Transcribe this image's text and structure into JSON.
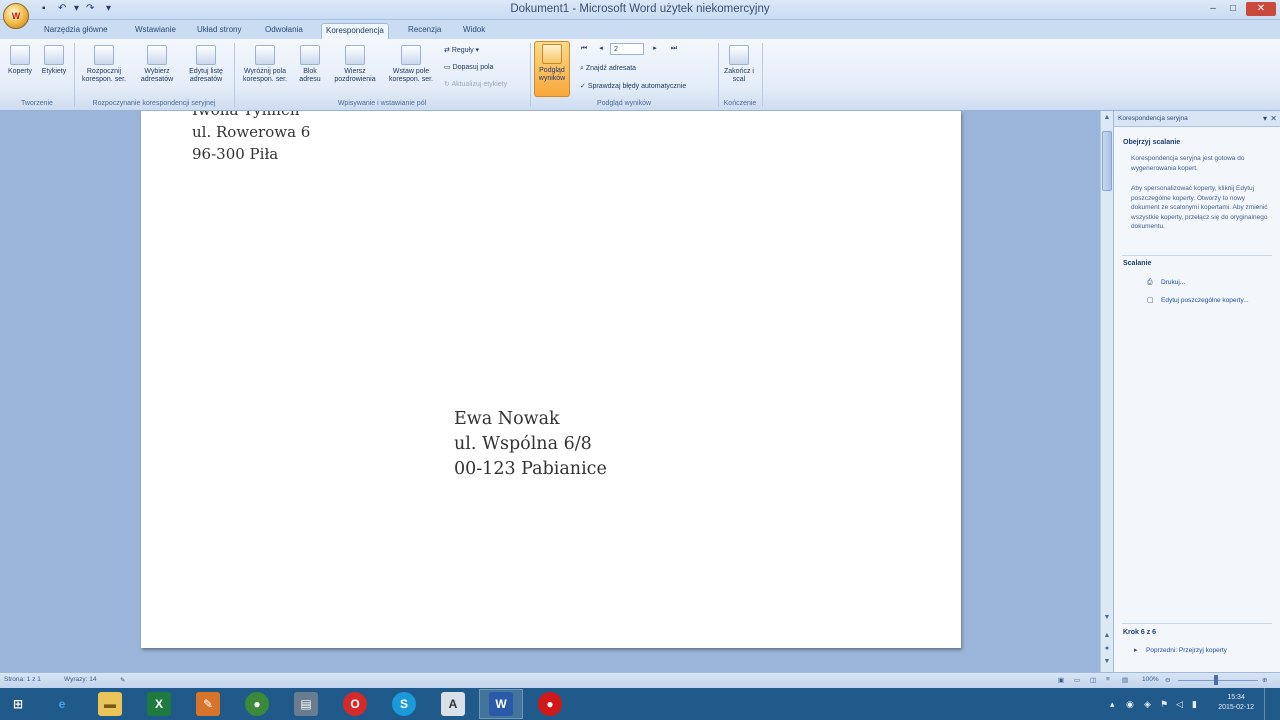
{
  "titlebar": {
    "title": "Dokument1 - Microsoft Word użytek niekomercyjny",
    "minimize": "–",
    "maximize": "□",
    "close": "✕"
  },
  "tabs": [
    "Narzędzia główne",
    "Wstawianie",
    "Układ strony",
    "Odwołania",
    "Korespondencja",
    "Recenzja",
    "Widok"
  ],
  "ribbon": {
    "create_group": {
      "koperty": "Koperty",
      "etykiety": "Etykiety",
      "label": "Tworzenie"
    },
    "start_group": {
      "rozpocznij": "Rozpocznij korespon. ser.",
      "wybierz": "Wybierz adresatów",
      "edytuj": "Edytuj listę adresatów",
      "label": "Rozpoczynanie korespondencji seryjnej"
    },
    "write_group": {
      "wyroznij": "Wyróżnij pola korespon. ser.",
      "blok": "Blok adresu",
      "wiersz": "Wiersz pozdrowienia",
      "wstaw": "Wstaw pole korespon. ser.",
      "reguly": "Reguły",
      "dopasuj": "Dopasuj pola",
      "aktualizuj": "Aktualizuj etykiety",
      "label": "Wpisywanie i wstawianie pól"
    },
    "preview_group": {
      "podglad": "Podgląd wyników",
      "record": "2",
      "znajdz": "Znajdź adresata",
      "sprawdz": "Sprawdzaj błędy automatycznie",
      "label": "Podgląd wyników"
    },
    "finish_group": {
      "zakoncz": "Zakończ i scal",
      "label": "Kończenie"
    }
  },
  "document": {
    "sender": [
      "Iwona Tynnen",
      "ul. Rowerowa 6",
      "96-300 Piła"
    ],
    "recipient": [
      "Ewa Nowak",
      "ul. Wspólna 6/8",
      "00-123 Pabianice"
    ]
  },
  "pane": {
    "title": "Korespondencja seryjna",
    "heading1": "Obejrzyj scalanie",
    "para1": "Korespondencja seryjna jest gotowa do wygenerowania kopert.",
    "para2": "Aby spersonalizować koperty, kliknij Edytuj poszczególne koperty. Otworzy to nowy dokument ze scalonymi kopertami. Aby zmienić wszystkie koperty, przełącz się do oryginalnego dokumentu.",
    "heading2": "Scalanie",
    "link1": "Drukuj...",
    "link2": "Edytuj poszczególne koperty...",
    "step": "Krok 6 z 6",
    "back": "Poprzedni: Przejrzyj koperty"
  },
  "statusbar": {
    "page": "Strona: 1 z 1",
    "words": "Wyrazy: 14",
    "zoom": "100%"
  },
  "taskbar": {
    "time": "15:34",
    "date": "2015-02-12"
  }
}
